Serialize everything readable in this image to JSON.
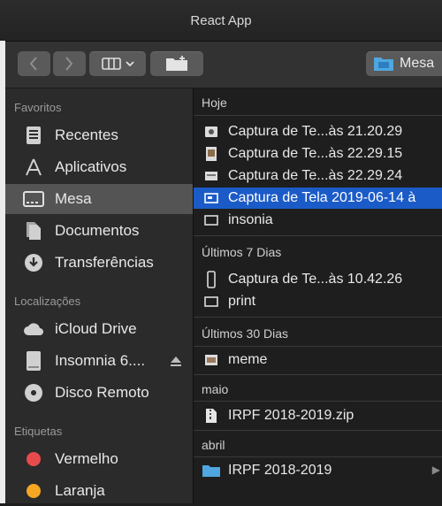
{
  "window": {
    "title": "React App"
  },
  "toolbar": {
    "location_label": "Mesa"
  },
  "sidebar": {
    "sections": [
      {
        "label": "Favoritos"
      },
      {
        "label": "Localizações"
      },
      {
        "label": "Etiquetas"
      }
    ],
    "favorites": [
      {
        "label": "Recentes",
        "icon": "recents-icon"
      },
      {
        "label": "Aplicativos",
        "icon": "applications-icon"
      },
      {
        "label": "Mesa",
        "icon": "desktop-icon",
        "selected": true
      },
      {
        "label": "Documentos",
        "icon": "documents-icon"
      },
      {
        "label": "Transferências",
        "icon": "downloads-icon"
      }
    ],
    "locations": [
      {
        "label": "iCloud Drive",
        "icon": "icloud-icon"
      },
      {
        "label": "Insomnia 6....",
        "icon": "disk-icon",
        "ejectable": true
      },
      {
        "label": "Disco Remoto",
        "icon": "remote-disc-icon"
      }
    ],
    "tags": [
      {
        "label": "Vermelho",
        "color": "#e84b4b"
      },
      {
        "label": "Laranja",
        "color": "#f5a623"
      }
    ]
  },
  "groups": [
    {
      "label": "Hoje",
      "items": [
        {
          "name": "Captura de Te...às 21.20.29",
          "icon": "screenshot-icon"
        },
        {
          "name": "Captura de Te...às 22.29.15",
          "icon": "image-file-icon"
        },
        {
          "name": "Captura de Te...às 22.29.24",
          "icon": "screenshot-icon"
        },
        {
          "name": "Captura de Tela 2019-06-14 à",
          "icon": "screenshot-icon",
          "selected": true
        },
        {
          "name": "insonia",
          "icon": "screenshot-icon"
        }
      ]
    },
    {
      "label": "Últimos 7 Dias",
      "items": [
        {
          "name": "Captura de Te...às 10.42.26",
          "icon": "phone-screenshot-icon"
        },
        {
          "name": "print",
          "icon": "screenshot-icon"
        }
      ]
    },
    {
      "label": "Últimos 30 Dias",
      "items": [
        {
          "name": "meme",
          "icon": "image-file-icon"
        }
      ]
    },
    {
      "label": "maio",
      "items": [
        {
          "name": "IRPF 2018-2019.zip",
          "icon": "zip-file-icon"
        }
      ]
    },
    {
      "label": "abril",
      "items": [
        {
          "name": "IRPF 2018-2019",
          "icon": "folder-icon",
          "folder": true
        }
      ]
    }
  ]
}
